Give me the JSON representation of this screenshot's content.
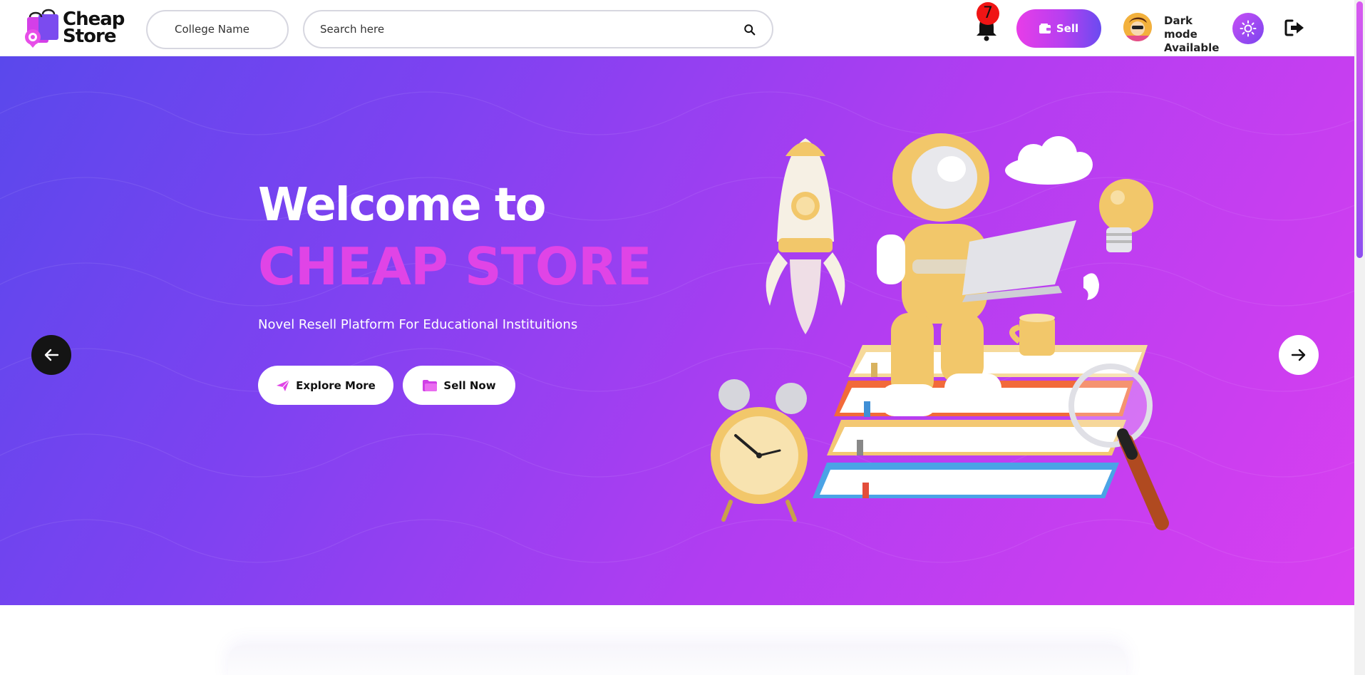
{
  "header": {
    "logo_line1": "Cheap",
    "logo_line2": "Store",
    "college_label": "College Name",
    "search_placeholder": "Search here",
    "notification_count": "7",
    "sell_label": "Sell",
    "dark_mode_line1": "Dark mode",
    "dark_mode_line2": "Available"
  },
  "hero": {
    "welcome": "Welcome to",
    "brand": "CHEAP STORE",
    "tagline": "Novel Resell Platform For Educational Instituitions",
    "explore_label": "Explore More",
    "sell_now_label": "Sell Now"
  },
  "colors": {
    "accent": "#e044e6",
    "gradient_start": "#5a48ec",
    "gradient_end": "#d93ff0",
    "badge": "#f01515"
  },
  "icons": [
    "search-icon",
    "bell-icon",
    "wallet-icon",
    "sun-icon",
    "logout-icon",
    "paper-plane-icon",
    "folder-icon",
    "arrow-left-icon",
    "arrow-right-icon"
  ]
}
